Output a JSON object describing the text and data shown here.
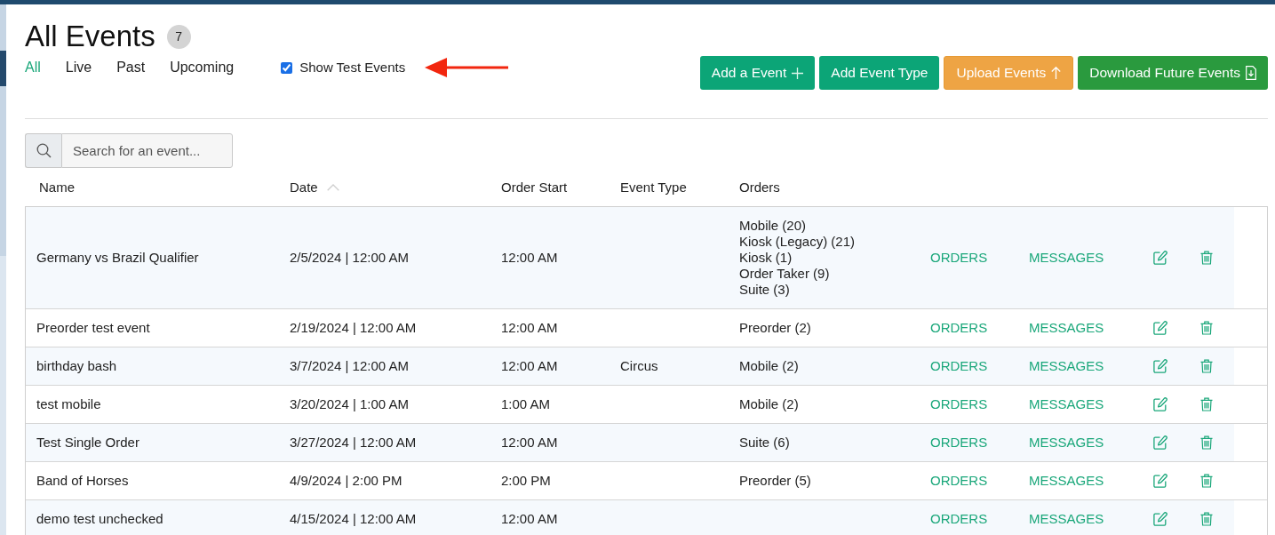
{
  "header": {
    "title": "All Events",
    "count": "7"
  },
  "filter_tabs": [
    {
      "label": "All",
      "selected": true
    },
    {
      "label": "Live",
      "selected": false
    },
    {
      "label": "Past",
      "selected": false
    },
    {
      "label": "Upcoming",
      "selected": false
    }
  ],
  "show_test_events": {
    "label": "Show Test Events",
    "checked": true
  },
  "buttons": [
    {
      "label": "Add a Event",
      "kind": "add"
    },
    {
      "label": "Add Event Type",
      "kind": "plain"
    },
    {
      "label": "Upload Events",
      "kind": "upload"
    },
    {
      "label": "Download Future Events",
      "kind": "download"
    }
  ],
  "search": {
    "placeholder": "Search for an event..."
  },
  "table": {
    "columns": [
      {
        "label": "Name",
        "sorted": false
      },
      {
        "label": "Date",
        "sorted": true
      },
      {
        "label": "Order Start",
        "sorted": false
      },
      {
        "label": "Event Type",
        "sorted": false
      },
      {
        "label": "Orders",
        "sorted": false
      }
    ],
    "rows": [
      {
        "name": "Germany vs Brazil Qualifier",
        "date": "2/5/2024 | 12:00 AM",
        "order_start": "12:00 AM",
        "orders": [
          "Mobile (20)",
          "Kiosk (Legacy) (21)",
          "Kiosk (1)",
          "Order Taker (9)",
          "Suite (3)"
        ],
        "orders_link": "ORDERS",
        "messages_link": "MESSAGES"
      },
      {
        "name": "Preorder test event",
        "date": "2/19/2024 | 12:00 AM",
        "order_start": "12:00 AM",
        "orders": [
          "Preorder (2)"
        ],
        "orders_link": "ORDERS",
        "messages_link": "MESSAGES"
      },
      {
        "name": "birthday bash",
        "date": "3/7/2024 | 12:00 AM",
        "order_start": "12:00 AM",
        "event_type": "Circus",
        "orders": [
          "Mobile (2)"
        ],
        "orders_link": "ORDERS",
        "messages_link": "MESSAGES"
      },
      {
        "name": "test mobile",
        "date": "3/20/2024 | 1:00 AM",
        "order_start": "1:00 AM",
        "orders": [
          "Mobile (2)"
        ],
        "orders_link": "ORDERS",
        "messages_link": "MESSAGES"
      },
      {
        "name": "Test Single Order",
        "date": "3/27/2024 | 12:00 AM",
        "order_start": "12:00 AM",
        "orders": [
          "Suite (6)"
        ],
        "orders_link": "ORDERS",
        "messages_link": "MESSAGES"
      },
      {
        "name": "Band of Horses",
        "date": "4/9/2024 | 2:00 PM",
        "order_start": "2:00 PM",
        "orders": [
          "Preorder (5)"
        ],
        "orders_link": "ORDERS",
        "messages_link": "MESSAGES"
      },
      {
        "name": "demo test unchecked",
        "date": "4/15/2024 | 12:00 AM",
        "order_start": "12:00 AM",
        "orders_link": "ORDERS",
        "messages_link": "MESSAGES"
      }
    ]
  }
}
